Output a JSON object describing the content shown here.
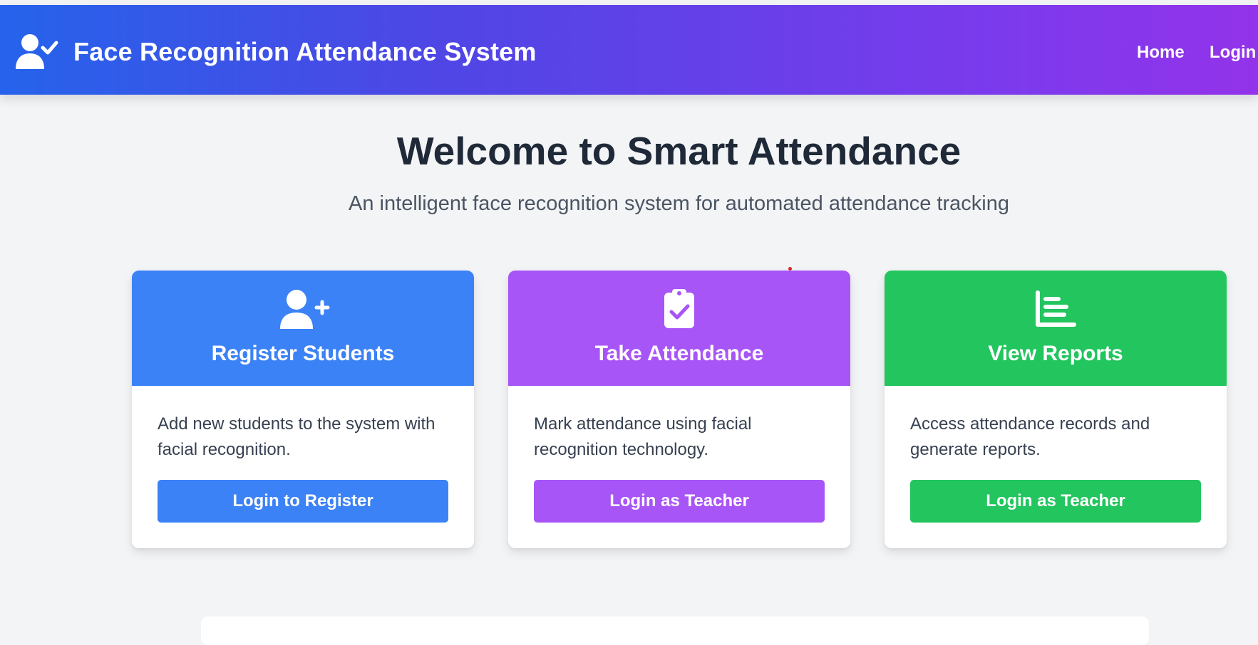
{
  "navbar": {
    "brand_title": "Face Recognition Attendance System",
    "brand_icon": "user-check-icon",
    "links": [
      {
        "label": "Home"
      },
      {
        "label": "Login"
      }
    ],
    "gradient_colors": [
      "#2563eb",
      "#4f46e5",
      "#7c3aed",
      "#9333ea"
    ]
  },
  "hero": {
    "title": "Welcome to Smart Attendance",
    "subtitle": "An intelligent face recognition system for automated attendance tracking"
  },
  "cards": [
    {
      "icon": "user-plus-icon",
      "title": "Register Students",
      "description": "Add new students to the system with facial recognition.",
      "button_label": "Login to Register",
      "color": "#3b82f6"
    },
    {
      "icon": "clipboard-check-icon",
      "title": "Take Attendance",
      "description": "Mark attendance using facial recognition technology.",
      "button_label": "Login as Teacher",
      "color": "#a855f7"
    },
    {
      "icon": "chart-bars-icon",
      "title": "View Reports",
      "description": "Access attendance records and generate reports.",
      "button_label": "Login as Teacher",
      "color": "#22c55e"
    }
  ],
  "colors": {
    "background": "#f3f4f6",
    "heading": "#1f2937",
    "subtext": "#4b5563",
    "card_text": "#374151"
  }
}
